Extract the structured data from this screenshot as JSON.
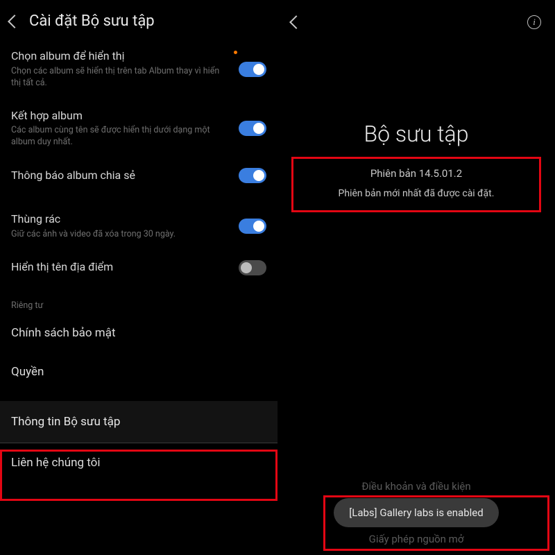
{
  "left": {
    "title": "Cài đặt Bộ sưu tập",
    "items": {
      "choose": {
        "label": "Chọn album để hiển thị",
        "sub": "Chọn các album sẽ hiển thị trên tab Album thay vì hiển thị tất cả."
      },
      "merge": {
        "label": "Kết hợp album",
        "sub": "Các album cùng tên sẽ được hiển thị dưới dạng một album duy nhất."
      },
      "share_notify": {
        "label": "Thông báo album chia sẻ"
      },
      "trash": {
        "label": "Thùng rác",
        "sub": "Giữ các ảnh và video đã xóa trong 30 ngày."
      },
      "location": {
        "label": "Hiển thị tên địa điểm"
      },
      "privacy_section": "Riêng tư",
      "privacy": "Chính sách bảo mật",
      "permissions": "Quyền",
      "about": "Thông tin Bộ sưu tập",
      "contact": "Liên hệ chúng tôi"
    }
  },
  "right": {
    "app_name": "Bộ sưu tập",
    "version": "Phiên bản 14.5.01.2",
    "latest": "Phiên bản mới nhất đã được cài đặt.",
    "terms": "Điều khoản và điều kiện",
    "open_source": "Giấy phép nguồn mở",
    "toast": "[Labs] Gallery labs is enabled"
  }
}
